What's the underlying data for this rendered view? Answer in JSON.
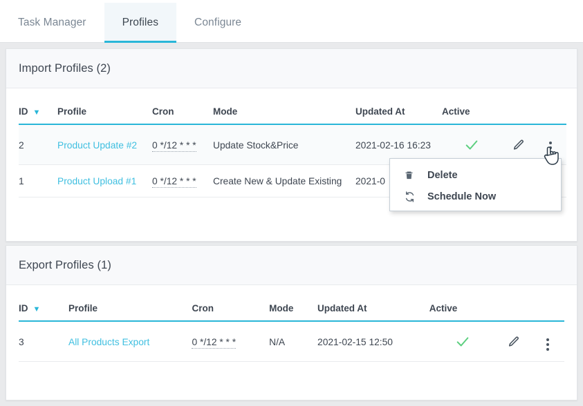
{
  "tabs": [
    {
      "label": "Task Manager",
      "active": false
    },
    {
      "label": "Profiles",
      "active": true
    },
    {
      "label": "Configure",
      "active": false
    }
  ],
  "icons": {
    "sort_chevron": "chevron-down-icon",
    "check": "check-icon",
    "pencil": "pencil-icon",
    "kebab": "kebab-menu-icon",
    "trash": "trash-icon",
    "refresh": "refresh-icon",
    "cursor": "pointer-cursor"
  },
  "colors": {
    "accent": "#29b6d8",
    "link": "#3fbfe0",
    "success": "#5ccf7f",
    "text": "#3e4651",
    "muted": "#7b8794",
    "page_bg": "#e9eaec",
    "panel_head_bg": "#f8f9fb"
  },
  "import_panel": {
    "title": "Import Profiles (2)",
    "columns": [
      "ID",
      "Profile",
      "Cron",
      "Mode",
      "Updated At",
      "Active",
      "",
      ""
    ],
    "rows": [
      {
        "id": "2",
        "profile": "Product Update #2",
        "cron": "0 */12 * * *",
        "mode": "Update Stock&Price",
        "updated_at": "2021-02-16 16:23",
        "active": true
      },
      {
        "id": "1",
        "profile": "Product Upload #1",
        "cron": "0 */12 * * *",
        "mode": "Create New & Update Existing",
        "updated_at": "2021-0",
        "active": true
      }
    ]
  },
  "export_panel": {
    "title": "Export Profiles (1)",
    "columns": [
      "ID",
      "Profile",
      "Cron",
      "Mode",
      "Updated At",
      "Active",
      "",
      ""
    ],
    "rows": [
      {
        "id": "3",
        "profile": "All Products Export",
        "cron": "0 */12 * * *",
        "mode": "N/A",
        "updated_at": "2021-02-15 12:50",
        "active": true
      }
    ]
  },
  "context_menu": {
    "items": [
      {
        "label": "Delete",
        "icon": "trash-icon"
      },
      {
        "label": "Schedule Now",
        "icon": "refresh-icon"
      }
    ]
  }
}
